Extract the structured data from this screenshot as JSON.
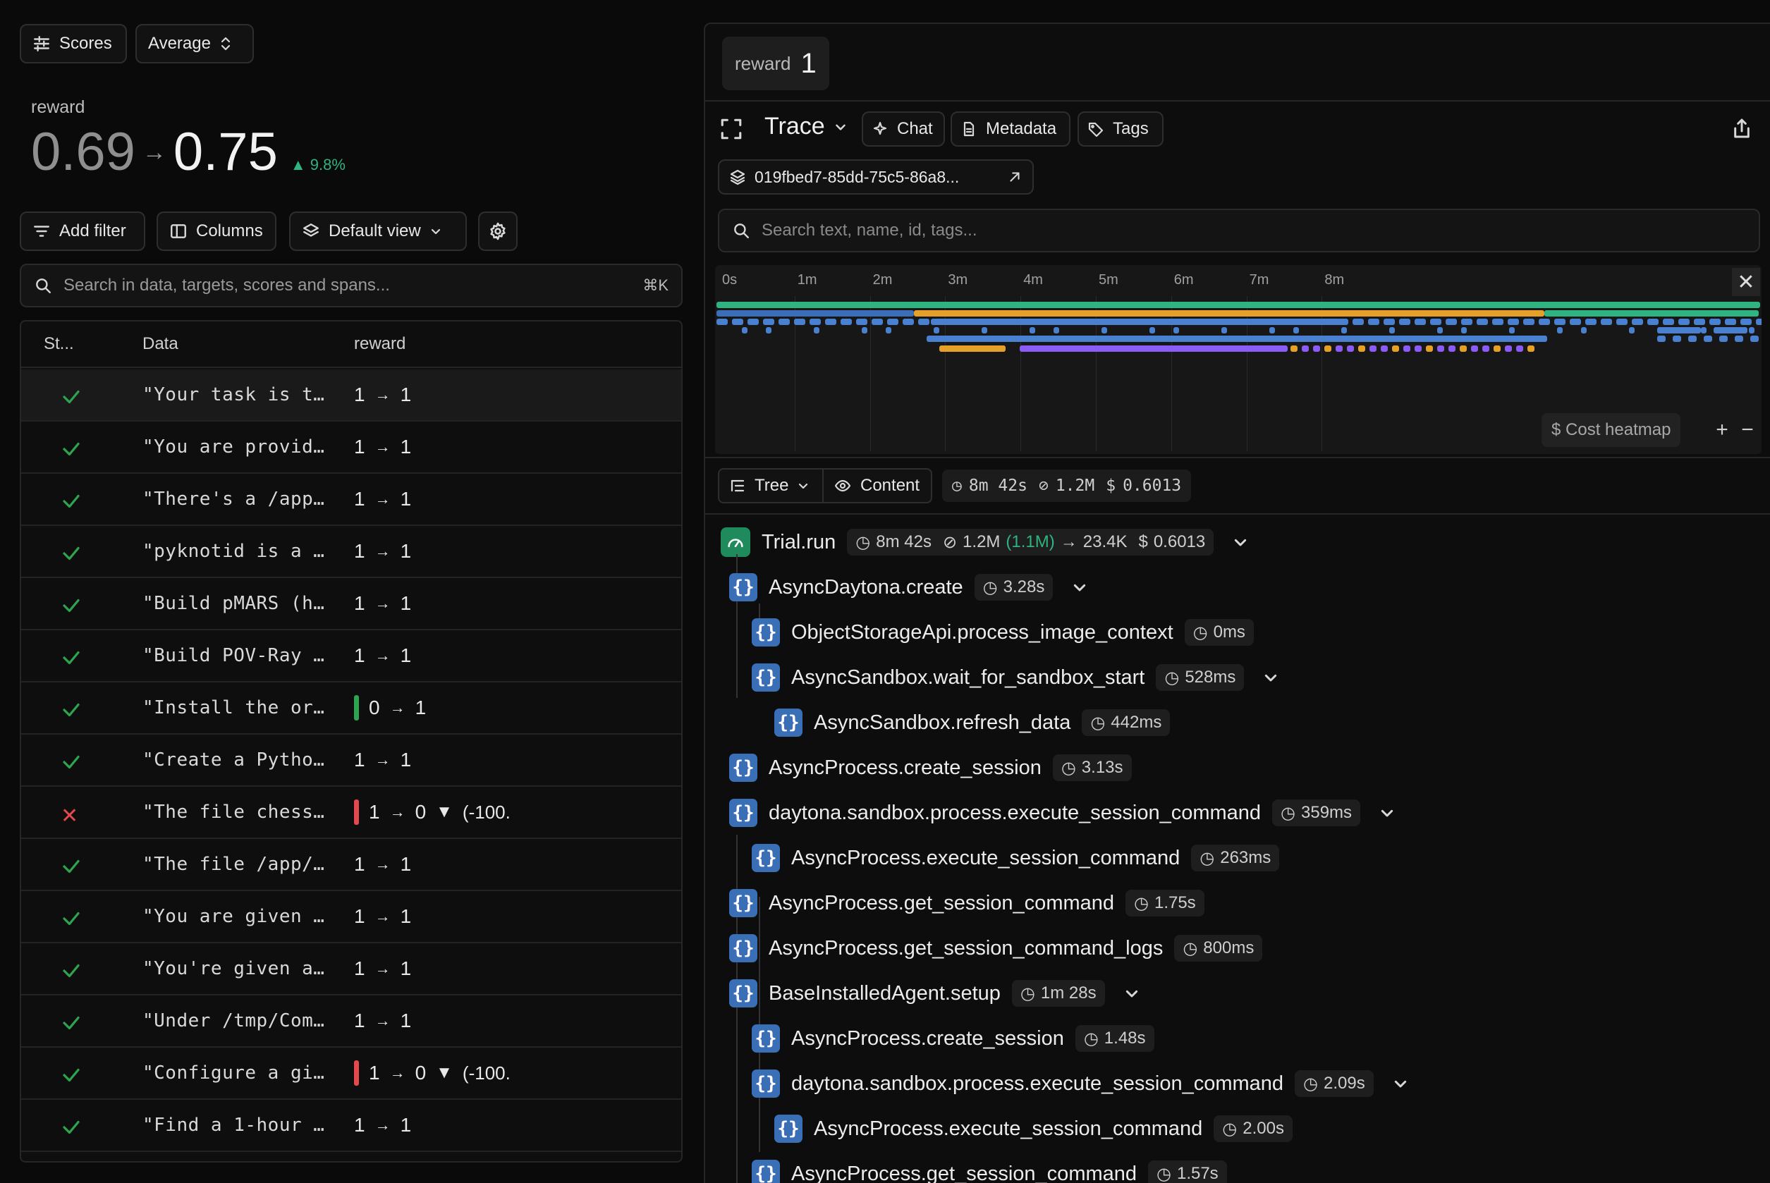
{
  "toolbar": {
    "scores_label": "Scores",
    "average_label": "Average"
  },
  "summary": {
    "metric": "reward",
    "from": "0.69",
    "to": "0.75",
    "delta": "9.8%"
  },
  "filters": {
    "add_filter": "Add filter",
    "columns": "Columns",
    "default_view": "Default view"
  },
  "search": {
    "placeholder": "Search in data, targets, scores and spans...",
    "shortcut": "⌘K"
  },
  "table": {
    "headers": [
      "St...",
      "Data",
      "reward"
    ],
    "rows": [
      {
        "status": "pass",
        "data": "\"Your task is t…",
        "from": "1",
        "to": "1",
        "change": ""
      },
      {
        "status": "pass",
        "data": "\"You are provid…",
        "from": "1",
        "to": "1",
        "change": ""
      },
      {
        "status": "pass",
        "data": "\"There's a /app…",
        "from": "1",
        "to": "1",
        "change": ""
      },
      {
        "status": "pass",
        "data": "\"pyknotid is a …",
        "from": "1",
        "to": "1",
        "change": ""
      },
      {
        "status": "pass",
        "data": "\"Build pMARS (h…",
        "from": "1",
        "to": "1",
        "change": ""
      },
      {
        "status": "pass",
        "data": "\"Build POV-Ray …",
        "from": "1",
        "to": "1",
        "change": ""
      },
      {
        "status": "pass",
        "data": "\"Install the or…",
        "from": "0",
        "to": "1",
        "change": "up"
      },
      {
        "status": "pass",
        "data": "\"Create a Pytho…",
        "from": "1",
        "to": "1",
        "change": ""
      },
      {
        "status": "fail",
        "data": "\"The file chess…",
        "from": "1",
        "to": "0",
        "change": "down",
        "pct": "(-100."
      },
      {
        "status": "pass",
        "data": "\"The file /app/…",
        "from": "1",
        "to": "1",
        "change": ""
      },
      {
        "status": "pass",
        "data": "\"You are given …",
        "from": "1",
        "to": "1",
        "change": ""
      },
      {
        "status": "pass",
        "data": "\"You're given a…",
        "from": "1",
        "to": "1",
        "change": ""
      },
      {
        "status": "pass",
        "data": "\"Under /tmp/Com…",
        "from": "1",
        "to": "1",
        "change": ""
      },
      {
        "status": "pass",
        "data": "\"Configure a gi…",
        "from": "1",
        "to": "0",
        "change": "down",
        "pct": "(-100."
      },
      {
        "status": "pass",
        "data": "\"Find a 1-hour …",
        "from": "1",
        "to": "1",
        "change": ""
      }
    ]
  },
  "trace": {
    "reward_label": "reward",
    "reward_value": "1",
    "title": "Trace",
    "chat": "Chat",
    "metadata": "Metadata",
    "tags": "Tags",
    "trace_id": "019fbed7-85dd-75c5-86a8...",
    "search_placeholder": "Search text, name, id, tags...",
    "timeline_ticks": [
      "0s",
      "1m",
      "2m",
      "3m",
      "4m",
      "5m",
      "6m",
      "7m",
      "8m"
    ],
    "cost_heatmap": "$ Cost heatmap",
    "tree_label": "Tree",
    "content_label": "Content",
    "stats": {
      "duration": "8m 42s",
      "tokens": "1.2M",
      "cost": "0.6013"
    },
    "root": {
      "name": "Trial.run",
      "duration": "8m 42s",
      "tokens": "1.2M",
      "cached": "(1.1M)",
      "output": "23.4K",
      "cost": "0.6013"
    },
    "spans": [
      {
        "name": "AsyncDaytona.create",
        "duration": "3.28s",
        "depth": 1,
        "expand": true
      },
      {
        "name": "ObjectStorageApi.process_image_context",
        "duration": "0ms",
        "depth": 2,
        "expand": false
      },
      {
        "name": "AsyncSandbox.wait_for_sandbox_start",
        "duration": "528ms",
        "depth": 2,
        "expand": true
      },
      {
        "name": "AsyncSandbox.refresh_data",
        "duration": "442ms",
        "depth": 3,
        "expand": false
      },
      {
        "name": "AsyncProcess.create_session",
        "duration": "3.13s",
        "depth": 1,
        "expand": false
      },
      {
        "name": "daytona.sandbox.process.execute_session_command",
        "duration": "359ms",
        "depth": 1,
        "expand": true
      },
      {
        "name": "AsyncProcess.execute_session_command",
        "duration": "263ms",
        "depth": 2,
        "expand": false
      },
      {
        "name": "AsyncProcess.get_session_command",
        "duration": "1.75s",
        "depth": 1,
        "expand": false
      },
      {
        "name": "AsyncProcess.get_session_command_logs",
        "duration": "800ms",
        "depth": 1,
        "expand": false
      },
      {
        "name": "BaseInstalledAgent.setup",
        "duration": "1m 28s",
        "depth": 1,
        "expand": true
      },
      {
        "name": "AsyncProcess.create_session",
        "duration": "1.48s",
        "depth": 2,
        "expand": false
      },
      {
        "name": "daytona.sandbox.process.execute_session_command",
        "duration": "2.09s",
        "depth": 2,
        "expand": true
      },
      {
        "name": "AsyncProcess.execute_session_command",
        "duration": "2.00s",
        "depth": 3,
        "expand": false
      },
      {
        "name": "AsyncProcess.get_session_command",
        "duration": "1.57s",
        "depth": 2,
        "expand": false
      }
    ]
  },
  "colors": {
    "green": "#2ea44f",
    "red": "#e5484d",
    "blue": "#3a6fb8",
    "orange": "#e5a02a",
    "purple": "#8b5cf6",
    "teal": "#2fb380"
  }
}
